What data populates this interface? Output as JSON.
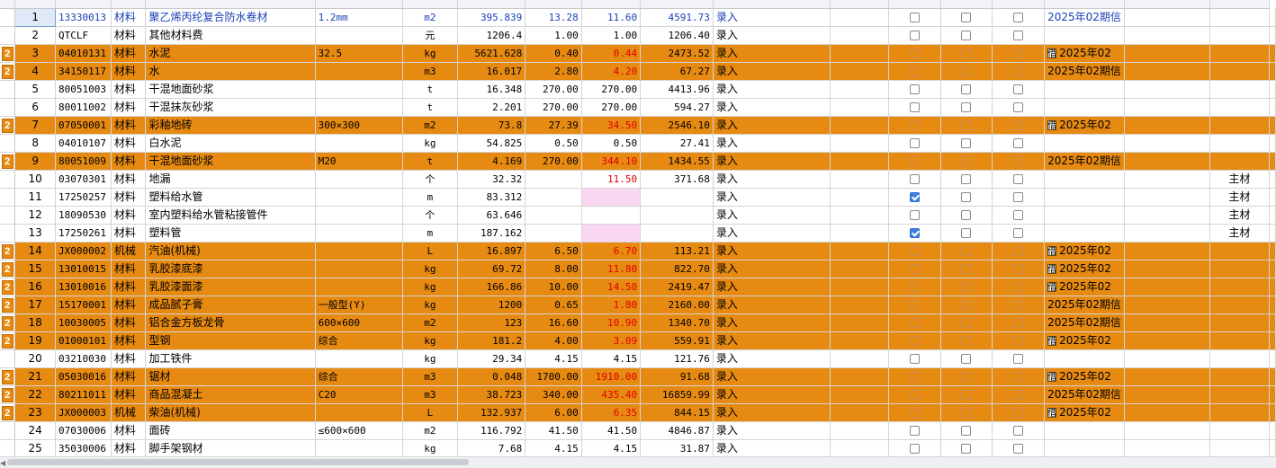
{
  "grid": {
    "rows": [
      {
        "n": "1",
        "code": "13330013",
        "type": "材料",
        "name": "聚乙烯丙纶复合防水卷材",
        "spec": "1.2mm",
        "unit": "m2",
        "qty": "395.839",
        "p1": "13.28",
        "p2": "11.60",
        "amount": "4591.73",
        "src": "录入",
        "c1": false,
        "c2": false,
        "c3": false,
        "period": "2025年02期信",
        "note": "",
        "hl": false,
        "sel": true,
        "red": false,
        "pink": false,
        "lock": false
      },
      {
        "n": "2",
        "code": "QTCLF",
        "type": "材料",
        "name": "其他材料费",
        "spec": "",
        "unit": "元",
        "qty": "1206.4",
        "p1": "1.00",
        "p2": "1.00",
        "amount": "1206.40",
        "src": "录入",
        "c1": false,
        "c2": false,
        "c3": false,
        "period": "",
        "note": "",
        "hl": false,
        "sel": false,
        "red": false,
        "pink": false,
        "lock": false
      },
      {
        "n": "3",
        "code": "04010131",
        "type": "材料",
        "name": "水泥",
        "spec": "32.5",
        "unit": "kg",
        "qty": "5621.628",
        "p1": "0.40",
        "p2": "0.44",
        "amount": "2473.52",
        "src": "录入",
        "c1": false,
        "c2": false,
        "c3": false,
        "period": "2025年02",
        "note": "",
        "hl": true,
        "sel": false,
        "red": true,
        "pink": false,
        "lock": true
      },
      {
        "n": "4",
        "code": "34150117",
        "type": "材料",
        "name": "水",
        "spec": "",
        "unit": "m3",
        "qty": "16.017",
        "p1": "2.80",
        "p2": "4.20",
        "amount": "67.27",
        "src": "录入",
        "c1": false,
        "c2": false,
        "c3": false,
        "period": "2025年02期信",
        "note": "",
        "hl": true,
        "sel": false,
        "red": true,
        "pink": false,
        "lock": false
      },
      {
        "n": "5",
        "code": "80051003",
        "type": "材料",
        "name": "干混地面砂浆",
        "spec": "",
        "unit": "t",
        "qty": "16.348",
        "p1": "270.00",
        "p2": "270.00",
        "amount": "4413.96",
        "src": "录入",
        "c1": false,
        "c2": false,
        "c3": false,
        "period": "",
        "note": "",
        "hl": false,
        "sel": false,
        "red": false,
        "pink": false,
        "lock": false
      },
      {
        "n": "6",
        "code": "80011002",
        "type": "材料",
        "name": "干混抹灰砂浆",
        "spec": "",
        "unit": "t",
        "qty": "2.201",
        "p1": "270.00",
        "p2": "270.00",
        "amount": "594.27",
        "src": "录入",
        "c1": false,
        "c2": false,
        "c3": false,
        "period": "",
        "note": "",
        "hl": false,
        "sel": false,
        "red": false,
        "pink": false,
        "lock": false
      },
      {
        "n": "7",
        "code": "07050001",
        "type": "材料",
        "name": "彩釉地砖",
        "spec": "300×300",
        "unit": "m2",
        "qty": "73.8",
        "p1": "27.39",
        "p2": "34.50",
        "amount": "2546.10",
        "src": "录入",
        "c1": false,
        "c2": false,
        "c3": false,
        "period": "2025年02",
        "note": "",
        "hl": true,
        "sel": false,
        "red": true,
        "pink": false,
        "lock": true
      },
      {
        "n": "8",
        "code": "04010107",
        "type": "材料",
        "name": "白水泥",
        "spec": "",
        "unit": "kg",
        "qty": "54.825",
        "p1": "0.50",
        "p2": "0.50",
        "amount": "27.41",
        "src": "录入",
        "c1": false,
        "c2": false,
        "c3": false,
        "period": "",
        "note": "",
        "hl": false,
        "sel": false,
        "red": false,
        "pink": false,
        "lock": false
      },
      {
        "n": "9",
        "code": "80051009",
        "type": "材料",
        "name": "干混地面砂浆",
        "spec": "M20",
        "unit": "t",
        "qty": "4.169",
        "p1": "270.00",
        "p2": "344.10",
        "amount": "1434.55",
        "src": "录入",
        "c1": false,
        "c2": false,
        "c3": false,
        "period": "2025年02期信",
        "note": "",
        "hl": true,
        "sel": false,
        "red": true,
        "pink": false,
        "lock": false
      },
      {
        "n": "10",
        "code": "03070301",
        "type": "材料",
        "name": "地漏",
        "spec": "",
        "unit": "个",
        "qty": "32.32",
        "p1": "",
        "p2": "11.50",
        "amount": "371.68",
        "src": "录入",
        "c1": false,
        "c2": false,
        "c3": false,
        "period": "",
        "note": "主材",
        "hl": false,
        "sel": false,
        "red": true,
        "pink": false,
        "lock": false
      },
      {
        "n": "11",
        "code": "17250257",
        "type": "材料",
        "name": "塑料给水管",
        "spec": "",
        "unit": "m",
        "qty": "83.312",
        "p1": "",
        "p2": "",
        "amount": "",
        "src": "录入",
        "c1": true,
        "c2": false,
        "c3": false,
        "period": "",
        "note": "主材",
        "hl": false,
        "sel": false,
        "red": false,
        "pink": true,
        "lock": false
      },
      {
        "n": "12",
        "code": "18090530",
        "type": "材料",
        "name": "室内塑料给水管粘接管件",
        "spec": "",
        "unit": "个",
        "qty": "63.646",
        "p1": "",
        "p2": "",
        "amount": "",
        "src": "录入",
        "c1": false,
        "c2": false,
        "c3": false,
        "period": "",
        "note": "主材",
        "hl": false,
        "sel": false,
        "red": false,
        "pink": false,
        "lock": false
      },
      {
        "n": "13",
        "code": "17250261",
        "type": "材料",
        "name": "塑料管",
        "spec": "",
        "unit": "m",
        "qty": "187.162",
        "p1": "",
        "p2": "",
        "amount": "",
        "src": "录入",
        "c1": true,
        "c2": false,
        "c3": false,
        "period": "",
        "note": "主材",
        "hl": false,
        "sel": false,
        "red": false,
        "pink": true,
        "lock": false
      },
      {
        "n": "14",
        "code": "JX000002",
        "type": "机械",
        "name": "汽油(机械)",
        "spec": "",
        "unit": "L",
        "qty": "16.897",
        "p1": "6.50",
        "p2": "6.70",
        "amount": "113.21",
        "src": "录入",
        "c1": false,
        "c2": false,
        "c3": false,
        "period": "2025年02",
        "note": "",
        "hl": true,
        "sel": false,
        "red": true,
        "pink": false,
        "lock": true
      },
      {
        "n": "15",
        "code": "13010015",
        "type": "材料",
        "name": "乳胶漆底漆",
        "spec": "",
        "unit": "kg",
        "qty": "69.72",
        "p1": "8.00",
        "p2": "11.80",
        "amount": "822.70",
        "src": "录入",
        "c1": false,
        "c2": false,
        "c3": false,
        "period": "2025年02",
        "note": "",
        "hl": true,
        "sel": false,
        "red": true,
        "pink": false,
        "lock": true
      },
      {
        "n": "16",
        "code": "13010016",
        "type": "材料",
        "name": "乳胶漆面漆",
        "spec": "",
        "unit": "kg",
        "qty": "166.86",
        "p1": "10.00",
        "p2": "14.50",
        "amount": "2419.47",
        "src": "录入",
        "c1": false,
        "c2": false,
        "c3": false,
        "period": "2025年02",
        "note": "",
        "hl": true,
        "sel": false,
        "red": true,
        "pink": false,
        "lock": true
      },
      {
        "n": "17",
        "code": "15170001",
        "type": "材料",
        "name": "成品腻子膏",
        "spec": "一般型(Y)",
        "unit": "kg",
        "qty": "1200",
        "p1": "0.65",
        "p2": "1.80",
        "amount": "2160.00",
        "src": "录入",
        "c1": false,
        "c2": false,
        "c3": false,
        "period": "2025年02期信",
        "note": "",
        "hl": true,
        "sel": false,
        "red": true,
        "pink": false,
        "lock": false
      },
      {
        "n": "18",
        "code": "10030005",
        "type": "材料",
        "name": "铝合金方板龙骨",
        "spec": "600×600",
        "unit": "m2",
        "qty": "123",
        "p1": "16.60",
        "p2": "10.90",
        "amount": "1340.70",
        "src": "录入",
        "c1": false,
        "c2": false,
        "c3": false,
        "period": "2025年02期信",
        "note": "",
        "hl": true,
        "sel": false,
        "red": true,
        "pink": false,
        "lock": false
      },
      {
        "n": "19",
        "code": "01000101",
        "type": "材料",
        "name": "型钢",
        "spec": "综合",
        "unit": "kg",
        "qty": "181.2",
        "p1": "4.00",
        "p2": "3.09",
        "amount": "559.91",
        "src": "录入",
        "c1": false,
        "c2": false,
        "c3": false,
        "period": "2025年02",
        "note": "",
        "hl": true,
        "sel": false,
        "red": true,
        "pink": false,
        "lock": true
      },
      {
        "n": "20",
        "code": "03210030",
        "type": "材料",
        "name": "加工铁件",
        "spec": "",
        "unit": "kg",
        "qty": "29.34",
        "p1": "4.15",
        "p2": "4.15",
        "amount": "121.76",
        "src": "录入",
        "c1": false,
        "c2": false,
        "c3": false,
        "period": "",
        "note": "",
        "hl": false,
        "sel": false,
        "red": false,
        "pink": false,
        "lock": false
      },
      {
        "n": "21",
        "code": "05030016",
        "type": "材料",
        "name": "锯材",
        "spec": "综合",
        "unit": "m3",
        "qty": "0.048",
        "p1": "1700.00",
        "p2": "1910.00",
        "amount": "91.68",
        "src": "录入",
        "c1": false,
        "c2": false,
        "c3": false,
        "period": "2025年02",
        "note": "",
        "hl": true,
        "sel": false,
        "red": true,
        "pink": false,
        "lock": true
      },
      {
        "n": "22",
        "code": "80211011",
        "type": "材料",
        "name": "商品混凝土",
        "spec": "C20",
        "unit": "m3",
        "qty": "38.723",
        "p1": "340.00",
        "p2": "435.40",
        "amount": "16859.99",
        "src": "录入",
        "c1": false,
        "c2": false,
        "c3": false,
        "period": "2025年02期信",
        "note": "",
        "hl": true,
        "sel": false,
        "red": true,
        "pink": false,
        "lock": false
      },
      {
        "n": "23",
        "code": "JX000003",
        "type": "机械",
        "name": "柴油(机械)",
        "spec": "",
        "unit": "L",
        "qty": "132.937",
        "p1": "6.00",
        "p2": "6.35",
        "amount": "844.15",
        "src": "录入",
        "c1": false,
        "c2": false,
        "c3": false,
        "period": "2025年02",
        "note": "",
        "hl": true,
        "sel": false,
        "red": true,
        "pink": false,
        "lock": true
      },
      {
        "n": "24",
        "code": "07030006",
        "type": "材料",
        "name": "面砖",
        "spec": "≤600×600",
        "unit": "m2",
        "qty": "116.792",
        "p1": "41.50",
        "p2": "41.50",
        "amount": "4846.87",
        "src": "录入",
        "c1": false,
        "c2": false,
        "c3": false,
        "period": "",
        "note": "",
        "hl": false,
        "sel": false,
        "red": false,
        "pink": false,
        "lock": false
      },
      {
        "n": "25",
        "code": "35030006",
        "type": "材料",
        "name": "脚手架钢材",
        "spec": "",
        "unit": "kg",
        "qty": "7.68",
        "p1": "4.15",
        "p2": "4.15",
        "amount": "31.87",
        "src": "录入",
        "c1": false,
        "c2": false,
        "c3": false,
        "period": "",
        "note": "",
        "hl": false,
        "sel": false,
        "red": false,
        "pink": false,
        "lock": false
      }
    ],
    "marker_glyph": "2",
    "lock_glyph": "借"
  },
  "colors": {
    "highlight": "#e78a12",
    "selection": "#dfe9f7",
    "red_price": "#e00000",
    "pink_cell": "#f9d6f2",
    "checkbox_checked": "#3b7fe0"
  }
}
